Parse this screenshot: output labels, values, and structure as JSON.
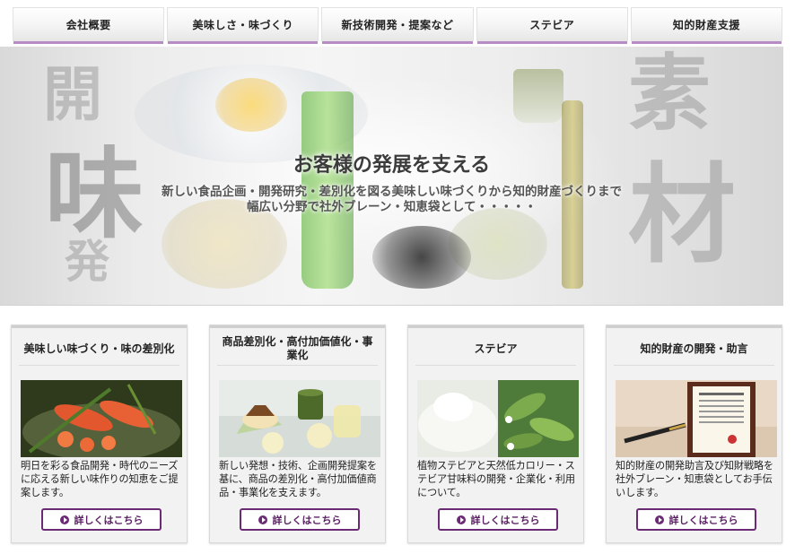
{
  "nav": {
    "items": [
      {
        "label": "会社概要"
      },
      {
        "label": "美味しさ・味づくり"
      },
      {
        "label": "新技術開発・提案など"
      },
      {
        "label": "ステビア"
      },
      {
        "label": "知的財産支援"
      }
    ]
  },
  "hero": {
    "title": "お客様の発展を支える",
    "line1": "新しい食品企画・開発研究・差別化を図る美味しい味づくりから知的財産づくりまで",
    "line2": "幅広い分野で社外ブレーン・知恵袋として・・・・・",
    "kanji_left": [
      "開",
      "味",
      "発"
    ],
    "kanji_right": [
      "素",
      "材"
    ]
  },
  "cards": [
    {
      "title": "美味しい味づくり・味の差別化",
      "text": "明日を彩る食品開発・時代のニーズに応える新しい味作りの知恵をご提案します。",
      "button": "詳しくはこちら",
      "photo_icon": "food-photo"
    },
    {
      "title": "商品差別化・高付加価値化・事業化",
      "text": "新しい発想・技術、企画開発提案を基に、商品の差別化・高付加価値商品・事業化を支えます。",
      "button": "詳しくはこちら",
      "photo_icon": "dessert-photo"
    },
    {
      "title": "ステビア",
      "text": "植物ステビアと天然低カロリー・ステビア甘味料の開発・企業化・利用について。",
      "button": "詳しくはこちら",
      "photo_icon": "stevia-photo"
    },
    {
      "title": "知的財産の開発・助言",
      "text": "知的財産の開発助言及び知財戦略を社外ブレーン・知恵袋としてお手伝いします。",
      "button": "詳しくはこちら",
      "photo_icon": "certificate-photo"
    }
  ],
  "colors": {
    "accent": "#6b2a74",
    "nav_underline": "#b78bc4"
  }
}
